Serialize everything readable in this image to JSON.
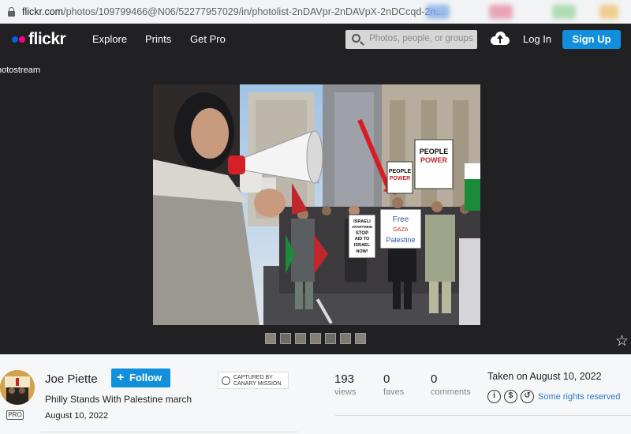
{
  "browser": {
    "url_host": "flickr.com",
    "url_path": "/photos/109799466@N06/52277957029/in/photolist-2nDAVpr-2nDAVpX-2nDCcqd-2n..."
  },
  "header": {
    "logo_text": "flickr",
    "nav": [
      "Explore",
      "Prints",
      "Get Pro"
    ],
    "search_placeholder": "Photos, people, or groups",
    "login_label": "Log In",
    "signup_label": "Sign Up"
  },
  "breadcrumb": "hotostream",
  "photo": {
    "protest_signs": [
      {
        "lines": [
          "PEOPLE",
          "POWER"
        ]
      },
      {
        "lines": [
          "PEOPLE",
          "POWER"
        ]
      },
      {
        "lines": [
          "ISRAELI",
          "APARTHEID",
          "STOP",
          "AID TO",
          "ISRAEL",
          "NOW!"
        ]
      },
      {
        "lines": [
          "Free",
          "GAZA",
          "Palestine"
        ]
      }
    ]
  },
  "info": {
    "author": "Joe Piette",
    "follow_label": "Follow",
    "pro_badge": "PRO",
    "title": "Philly Stands With Palestine march",
    "date": "August 10, 2022",
    "canary_badge": [
      "CAPTURED BY",
      "CANARY MISSION"
    ],
    "stats": [
      {
        "value": "193",
        "label": "views"
      },
      {
        "value": "0",
        "label": "faves"
      },
      {
        "value": "0",
        "label": "comments"
      }
    ],
    "taken_on": "Taken on August 10, 2022",
    "license_icons": [
      "i",
      "$",
      "↺"
    ],
    "rights_text": "Some rights reserved"
  },
  "colors": {
    "accent_blue": "#128fdc",
    "flickr_blue": "#0063dc",
    "flickr_pink": "#ff0084",
    "header_bg": "#212124",
    "link_blue": "#2f7bc4"
  }
}
